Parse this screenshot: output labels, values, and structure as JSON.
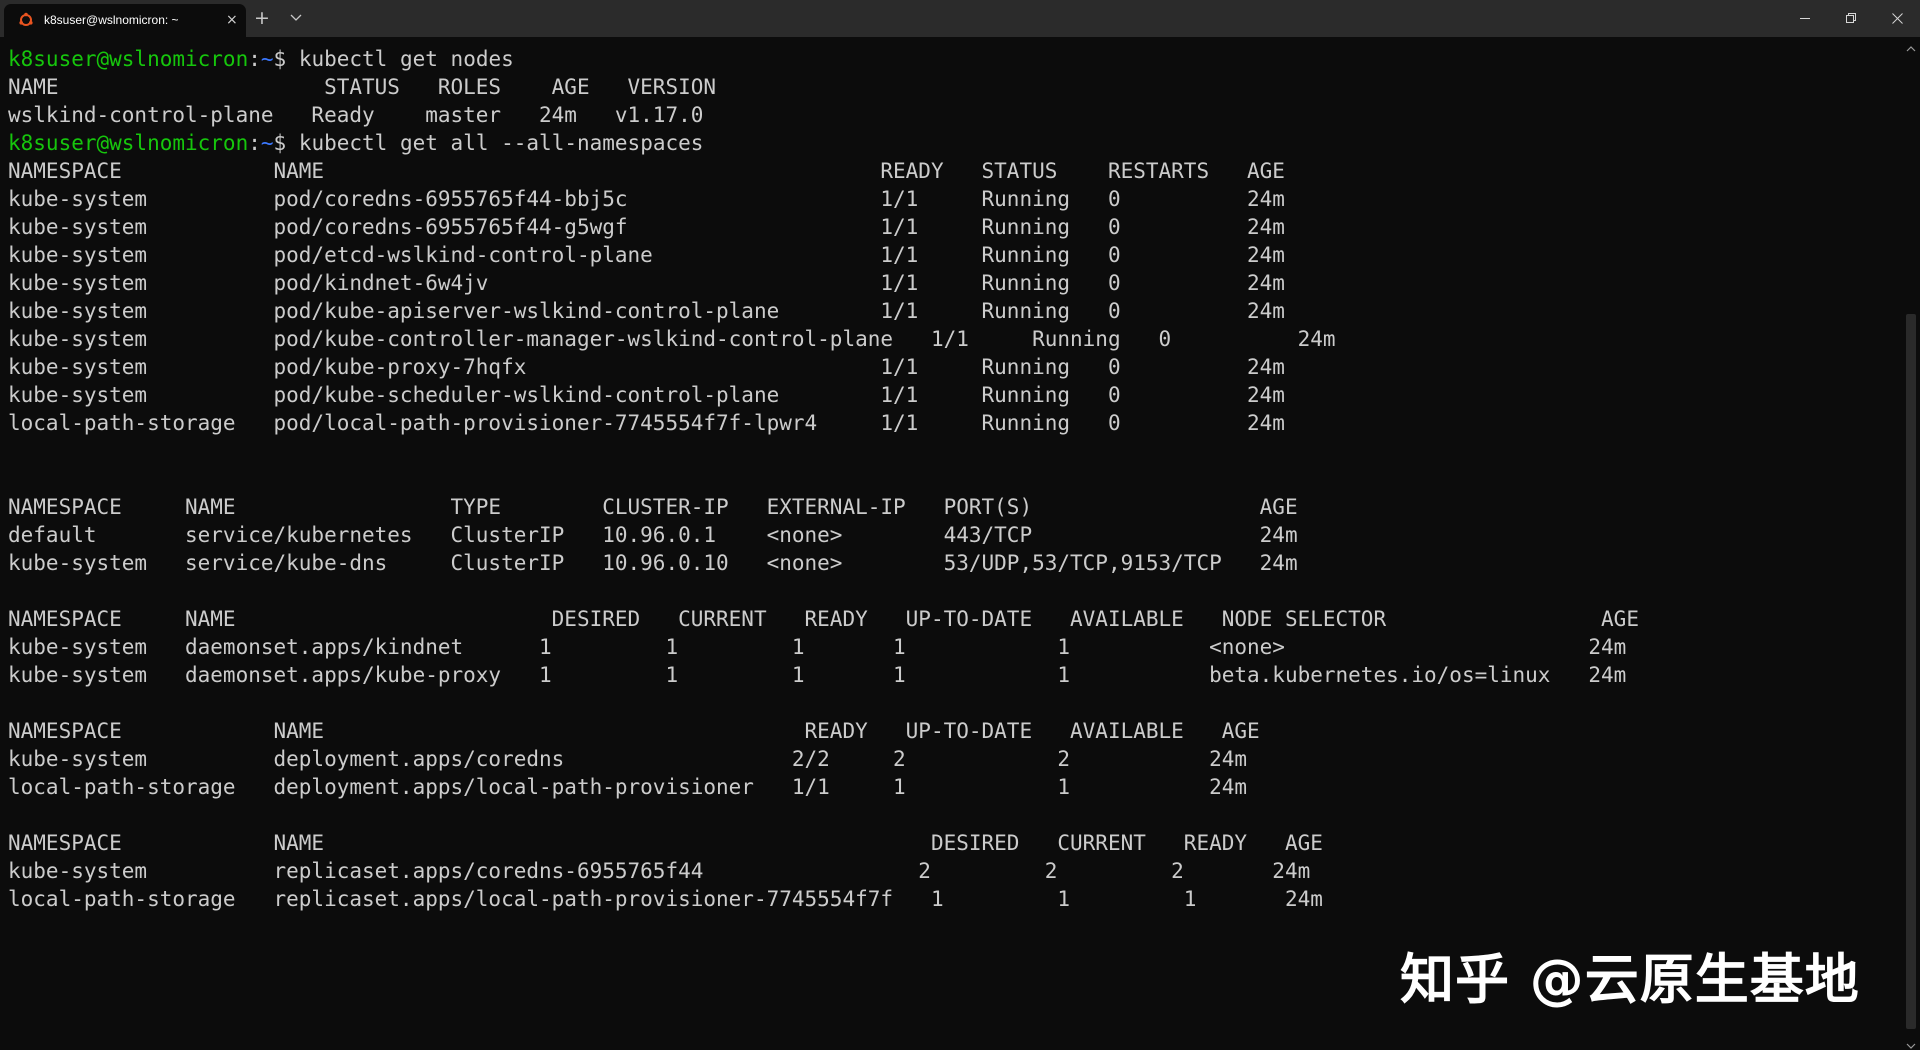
{
  "tab": {
    "title": "k8suser@wslnomicron: ~",
    "close_glyph": "×",
    "icon": "ubuntu-icon"
  },
  "tabbar": {
    "new_tab_glyph": "+",
    "dropdown_icon": "chevron-down-icon"
  },
  "window_controls": [
    "minimize-icon",
    "maximize-icon",
    "close-icon"
  ],
  "colors": {
    "background": "#0c0c0c",
    "titlebar": "#2b2b2b",
    "text": "#cccccc",
    "prompt_user": "#16c60c",
    "prompt_path": "#3b78ff"
  },
  "prompt": {
    "user_host": "k8suser@wslnomicron",
    "colon": ":",
    "path": "~",
    "symbol": "$ "
  },
  "lines": [
    {
      "type": "prompt",
      "command": "kubectl get nodes"
    },
    {
      "type": "text",
      "text": "NAME                     STATUS   ROLES    AGE   VERSION"
    },
    {
      "type": "text",
      "text": "wslkind-control-plane   Ready    master   24m   v1.17.0"
    },
    {
      "type": "prompt",
      "command": "kubectl get all --all-namespaces"
    },
    {
      "type": "text",
      "text": "NAMESPACE            NAME                                            READY   STATUS    RESTARTS   AGE"
    },
    {
      "type": "text",
      "text": "kube-system          pod/coredns-6955765f44-bbj5c                    1/1     Running   0          24m"
    },
    {
      "type": "text",
      "text": "kube-system          pod/coredns-6955765f44-g5wgf                    1/1     Running   0          24m"
    },
    {
      "type": "text",
      "text": "kube-system          pod/etcd-wslkind-control-plane                  1/1     Running   0          24m"
    },
    {
      "type": "text",
      "text": "kube-system          pod/kindnet-6w4jv                               1/1     Running   0          24m"
    },
    {
      "type": "text",
      "text": "kube-system          pod/kube-apiserver-wslkind-control-plane        1/1     Running   0          24m"
    },
    {
      "type": "text",
      "text": "kube-system          pod/kube-controller-manager-wslkind-control-plane   1/1     Running   0          24m"
    },
    {
      "type": "text",
      "text": "kube-system          pod/kube-proxy-7hqfx                            1/1     Running   0          24m"
    },
    {
      "type": "text",
      "text": "kube-system          pod/kube-scheduler-wslkind-control-plane        1/1     Running   0          24m"
    },
    {
      "type": "text",
      "text": "local-path-storage   pod/local-path-provisioner-7745554f7f-lpwr4     1/1     Running   0          24m"
    },
    {
      "type": "text",
      "text": ""
    },
    {
      "type": "text",
      "text": ""
    },
    {
      "type": "text",
      "text": "NAMESPACE     NAME                 TYPE        CLUSTER-IP   EXTERNAL-IP   PORT(S)                  AGE"
    },
    {
      "type": "text",
      "text": "default       service/kubernetes   ClusterIP   10.96.0.1    <none>        443/TCP                  24m"
    },
    {
      "type": "text",
      "text": "kube-system   service/kube-dns     ClusterIP   10.96.0.10   <none>        53/UDP,53/TCP,9153/TCP   24m"
    },
    {
      "type": "text",
      "text": ""
    },
    {
      "type": "text",
      "text": "NAMESPACE     NAME                         DESIRED   CURRENT   READY   UP-TO-DATE   AVAILABLE   NODE SELECTOR                 AGE"
    },
    {
      "type": "text",
      "text": "kube-system   daemonset.apps/kindnet      1         1         1       1            1           <none>                        24m"
    },
    {
      "type": "text",
      "text": "kube-system   daemonset.apps/kube-proxy   1         1         1       1            1           beta.kubernetes.io/os=linux   24m"
    },
    {
      "type": "text",
      "text": ""
    },
    {
      "type": "text",
      "text": "NAMESPACE            NAME                                      READY   UP-TO-DATE   AVAILABLE   AGE"
    },
    {
      "type": "text",
      "text": "kube-system          deployment.apps/coredns                  2/2     2            2           24m"
    },
    {
      "type": "text",
      "text": "local-path-storage   deployment.apps/local-path-provisioner   1/1     1            1           24m"
    },
    {
      "type": "text",
      "text": ""
    },
    {
      "type": "text",
      "text": "NAMESPACE            NAME                                                DESIRED   CURRENT   READY   AGE"
    },
    {
      "type": "text",
      "text": "kube-system          replicaset.apps/coredns-6955765f44                 2         2         2       24m"
    },
    {
      "type": "text",
      "text": "local-path-storage   replicaset.apps/local-path-provisioner-7745554f7f   1         1         1       24m"
    }
  ],
  "watermark": "知乎 @云原生基地"
}
